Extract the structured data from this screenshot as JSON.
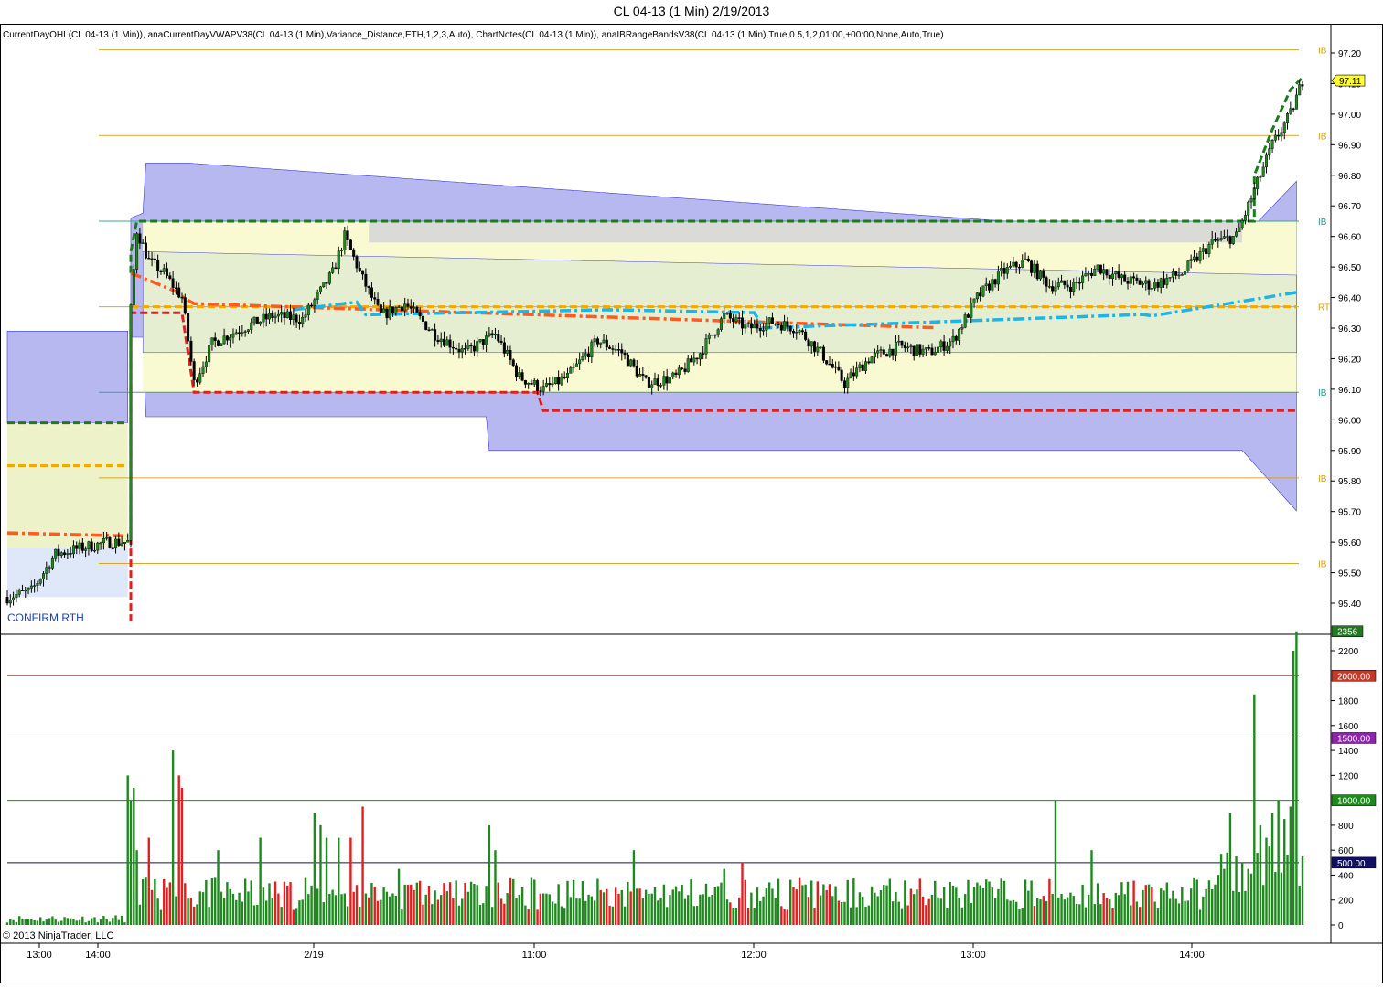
{
  "window": {
    "title": "CL 04-13 (1 Min)  2/19/2013",
    "indicator_header": "CurrentDayOHL(CL 04-13 (1 Min)), anaCurrentDayVWAPV38(CL 04-13 (1 Min),Variance_Distance,ETH,1,2,3,Auto), ChartNotes(CL 04-13 (1 Min)), anaIBRangeBandsV38(CL 04-13 (1 Min),True,0.5,1,2,01:00,+00:00,None,Auto,True)",
    "copyright": "© 2013 NinjaTrader, LLC",
    "note": "CONFIRM RTH"
  },
  "chart_data": [
    {
      "type": "candlestick",
      "instrument": "CL 04-13",
      "interval": "1 Min",
      "ylim": [
        95.35,
        97.25
      ],
      "y_ticks": [
        "97.20",
        "97.10",
        "97.00",
        "96.90",
        "96.80",
        "96.70",
        "96.60",
        "96.50",
        "96.40",
        "96.30",
        "96.20",
        "96.10",
        "96.00",
        "95.90",
        "95.80",
        "95.70",
        "95.60",
        "95.50",
        "95.40"
      ],
      "x_ticks": [
        "13:00",
        "14:00",
        "2/19",
        "11:00",
        "12:00",
        "13:00",
        "14:00"
      ],
      "last_price": "97.11",
      "level_lines": [
        {
          "label": "IB",
          "value": 97.21,
          "color": "#d4a017"
        },
        {
          "label": "IB",
          "value": 96.93,
          "color": "#d4a017"
        },
        {
          "label": "IB",
          "value": 96.65,
          "color": "#2a9d8f"
        },
        {
          "label": "RT",
          "value": 96.37,
          "color": "#d4a017"
        },
        {
          "label": "IB",
          "value": 96.09,
          "color": "#2a9d8f"
        },
        {
          "label": "IB",
          "value": 95.81,
          "color": "#d4a017"
        },
        {
          "label": "IB",
          "value": 95.53,
          "color": "#d4a017"
        }
      ],
      "series": [
        {
          "name": "Current day high",
          "style": "dashed",
          "color": "#1e7a1e"
        },
        {
          "name": "Current day low",
          "style": "dashed",
          "color": "#e02020"
        },
        {
          "name": "Current day open",
          "style": "dashed",
          "color": "#f5a800"
        },
        {
          "name": "VWAP",
          "style": "dash-dot",
          "color": "#ff5a1f"
        },
        {
          "name": "VWAP (RTH)",
          "style": "dash-dot",
          "color": "#1fb4e6"
        }
      ]
    },
    {
      "type": "bar",
      "name": "Volume",
      "ylim": [
        0,
        2400
      ],
      "y_ticks": [
        "2200",
        "1800",
        "1600",
        "1400",
        "1200",
        "800",
        "600",
        "400",
        "200",
        "0"
      ],
      "last_value": "2356",
      "reference_lines": [
        {
          "label": "2000.00",
          "value": 2000,
          "color": "#c0392b"
        },
        {
          "label": "1500.00",
          "value": 1500,
          "color": "#8e24aa"
        },
        {
          "label": "1000.00",
          "value": 1000,
          "color": "#1e8a1e"
        },
        {
          "label": "500.00",
          "value": 500,
          "color": "#101060"
        }
      ]
    }
  ]
}
